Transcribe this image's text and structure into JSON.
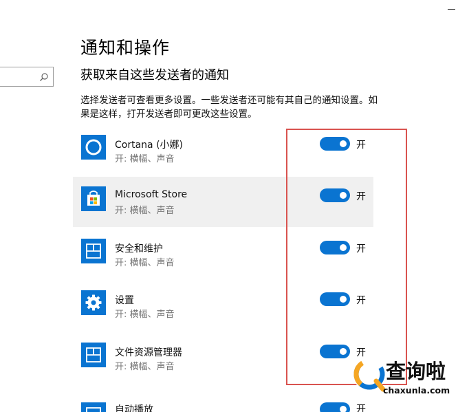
{
  "window": {
    "minimize_glyph": "–"
  },
  "search": {
    "value": "",
    "placeholder": ""
  },
  "page_title": "通知和操作",
  "section_title": "获取来自这些发送者的通知",
  "description": "选择发送者可查看更多设置。一些发送者还可能有其自己的通知设置。如果是这样，打开发送者即可更改这些设置。",
  "senders": [
    {
      "name": "Cortana (小娜)",
      "sub": "开: 横幅、声音",
      "toggle": "开",
      "icon": "cortana-icon",
      "on": true
    },
    {
      "name": "Microsoft Store",
      "sub": "开: 横幅、声音",
      "toggle": "开",
      "icon": "store-icon",
      "on": true
    },
    {
      "name": "安全和维护",
      "sub": "开: 横幅、声音",
      "toggle": "开",
      "icon": "app-window-icon",
      "on": true
    },
    {
      "name": "设置",
      "sub": "开: 横幅、声音",
      "toggle": "开",
      "icon": "gear-icon",
      "on": true
    },
    {
      "name": "文件资源管理器",
      "sub": "开: 横幅、声音",
      "toggle": "开",
      "icon": "app-window-icon",
      "on": true
    },
    {
      "name": "自动播放",
      "sub": "",
      "toggle": "开",
      "icon": "app-window-icon",
      "on": true
    }
  ],
  "watermark": {
    "brand": "查询啦",
    "domain": "chaxunla.com"
  },
  "colors": {
    "accent": "#0a74d1",
    "highlight": "#d9534f",
    "watermark_orange": "#f5a623"
  }
}
